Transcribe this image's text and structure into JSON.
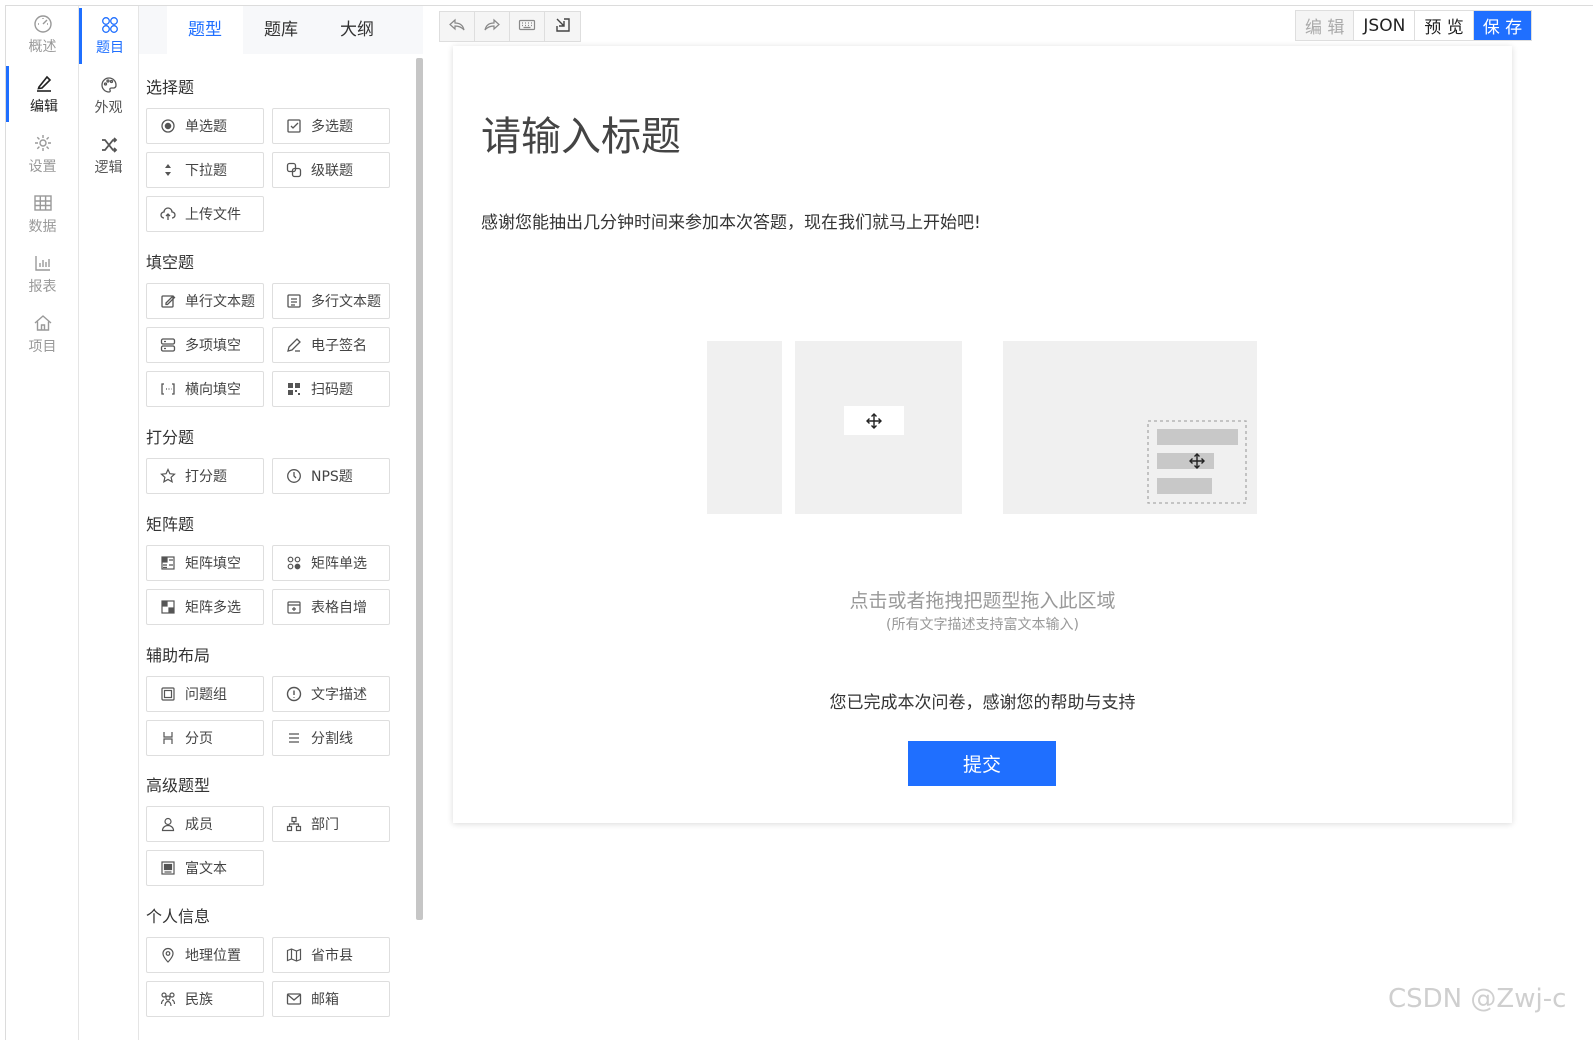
{
  "main_nav": [
    {
      "label": "概述",
      "icon": "dashboard-icon"
    },
    {
      "label": "编辑",
      "icon": "edit-icon",
      "active": true
    },
    {
      "label": "设置",
      "icon": "gear-icon"
    },
    {
      "label": "数据",
      "icon": "table-icon"
    },
    {
      "label": "报表",
      "icon": "bar-chart-icon"
    },
    {
      "label": "项目",
      "icon": "home-icon"
    }
  ],
  "sub_nav": [
    {
      "label": "题目",
      "icon": "question-icon",
      "active": true
    },
    {
      "label": "外观",
      "icon": "palette-icon"
    },
    {
      "label": "逻辑",
      "icon": "shuffle-icon"
    }
  ],
  "panel_tabs": [
    "题型",
    "题库",
    "大纲"
  ],
  "groups": [
    {
      "title": "选择题",
      "items": [
        {
          "label": "单选题",
          "icon": "radio-icon"
        },
        {
          "label": "多选题",
          "icon": "checkbox-icon"
        },
        {
          "label": "下拉题",
          "icon": "dropdown-icon"
        },
        {
          "label": "级联题",
          "icon": "cascade-icon"
        },
        {
          "label": "上传文件",
          "icon": "upload-icon"
        }
      ]
    },
    {
      "title": "填空题",
      "items": [
        {
          "label": "单行文本题",
          "icon": "single-line-icon"
        },
        {
          "label": "多行文本题",
          "icon": "multi-line-icon"
        },
        {
          "label": "多项填空",
          "icon": "multi-fill-icon"
        },
        {
          "label": "电子签名",
          "icon": "signature-icon"
        },
        {
          "label": "横向填空",
          "icon": "inline-fill-icon"
        },
        {
          "label": "扫码题",
          "icon": "barcode-icon"
        }
      ]
    },
    {
      "title": "打分题",
      "items": [
        {
          "label": "打分题",
          "icon": "star-icon"
        },
        {
          "label": "NPS题",
          "icon": "nps-icon"
        }
      ]
    },
    {
      "title": "矩阵题",
      "items": [
        {
          "label": "矩阵填空",
          "icon": "matrix-fill-icon"
        },
        {
          "label": "矩阵单选",
          "icon": "matrix-radio-icon"
        },
        {
          "label": "矩阵多选",
          "icon": "matrix-check-icon"
        },
        {
          "label": "表格自增",
          "icon": "table-add-icon"
        }
      ]
    },
    {
      "title": "辅助布局",
      "items": [
        {
          "label": "问题组",
          "icon": "group-icon"
        },
        {
          "label": "文字描述",
          "icon": "info-icon"
        },
        {
          "label": "分页",
          "icon": "page-break-icon"
        },
        {
          "label": "分割线",
          "icon": "divider-icon"
        }
      ]
    },
    {
      "title": "高级题型",
      "items": [
        {
          "label": "成员",
          "icon": "user-icon"
        },
        {
          "label": "部门",
          "icon": "org-icon"
        },
        {
          "label": "富文本",
          "icon": "rich-text-icon"
        }
      ]
    },
    {
      "title": "个人信息",
      "items": [
        {
          "label": "地理位置",
          "icon": "location-icon"
        },
        {
          "label": "省市县",
          "icon": "map-icon"
        },
        {
          "label": "民族",
          "icon": "people-icon"
        },
        {
          "label": "邮箱",
          "icon": "mail-icon"
        }
      ]
    }
  ],
  "toolbar": {
    "undo_icon": "undo-icon",
    "redo_icon": "redo-icon",
    "keyboard_icon": "keyboard-icon",
    "import_icon": "import-icon",
    "edit_label": "编 辑",
    "json_label": "JSON",
    "preview_label": "预 览",
    "save_label": "保 存"
  },
  "form": {
    "title": "请输入标题",
    "description": "感谢您能抽出几分钟时间来参加本次答题，现在我们就马上开始吧!",
    "drop_hint": "点击或者拖拽把题型拖入此区域",
    "drop_sub": "(所有文字描述支持富文本输入)",
    "finish_text": "您已完成本次问卷，感谢您的帮助与支持",
    "submit_label": "提交"
  },
  "watermark": "CSDN @Zwj-c",
  "colors": {
    "accent": "#1f6fff",
    "border": "#dedede",
    "muted": "#999999"
  }
}
